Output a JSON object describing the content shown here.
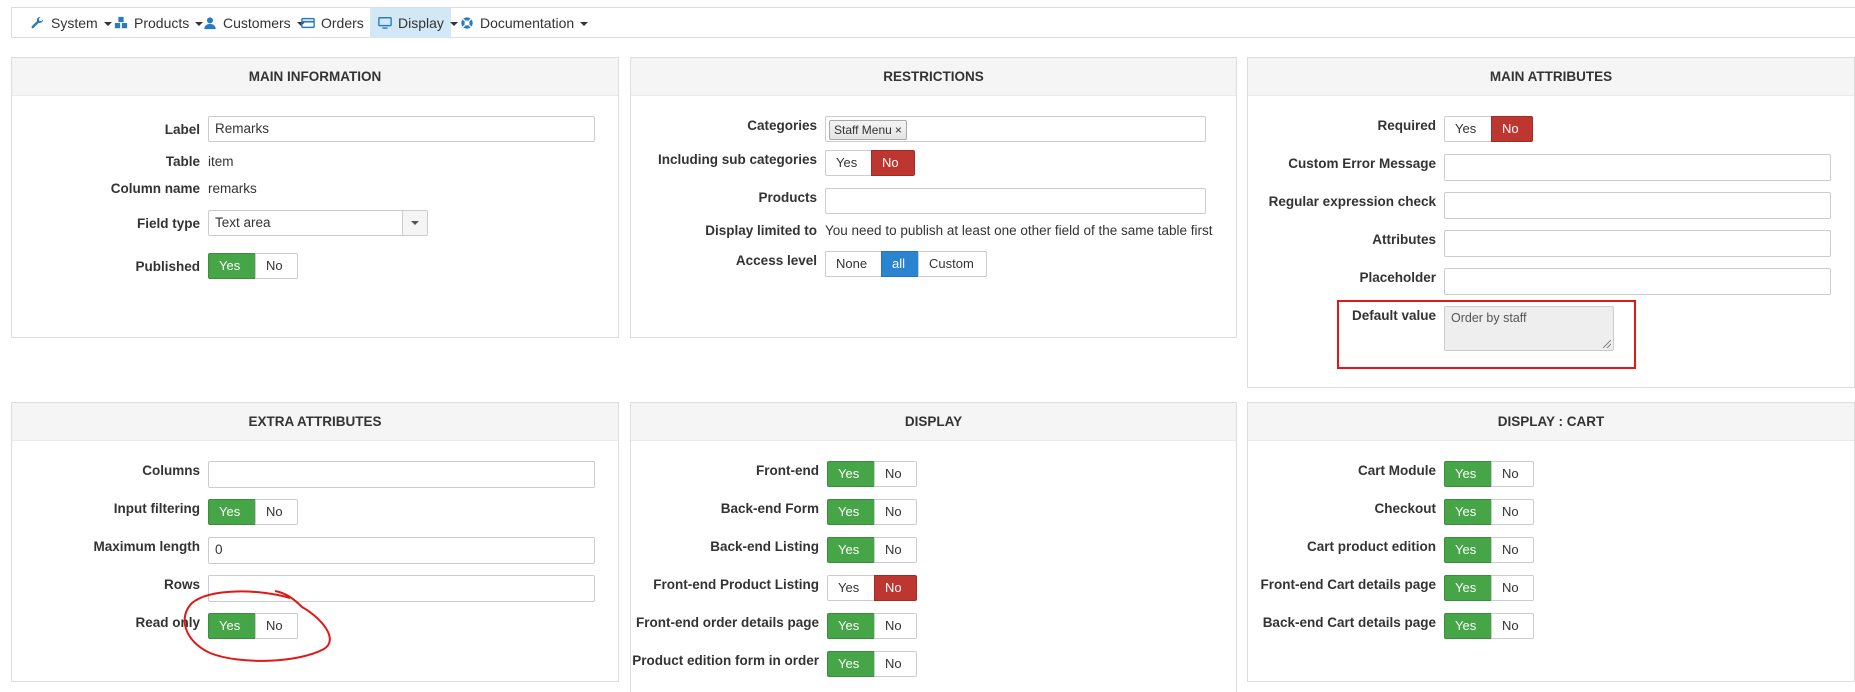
{
  "nav": {
    "items": [
      {
        "label": "System",
        "icon": "wrench-icon"
      },
      {
        "label": "Products",
        "icon": "cubes-icon"
      },
      {
        "label": "Customers",
        "icon": "user-icon"
      },
      {
        "label": "Orders",
        "icon": "credit-card-icon"
      },
      {
        "label": "Display",
        "icon": "monitor-icon"
      },
      {
        "label": "Documentation",
        "icon": "lifebuoy-icon"
      }
    ],
    "active": "Display"
  },
  "main_info": {
    "title": "MAIN INFORMATION",
    "label_lbl": "Label",
    "label_val": "Remarks",
    "table_lbl": "Table",
    "table_val": "item",
    "column_lbl": "Column name",
    "column_val": "remarks",
    "fieldtype_lbl": "Field type",
    "fieldtype_val": "Text area",
    "published_lbl": "Published",
    "yes": "Yes",
    "no": "No"
  },
  "restrictions": {
    "title": "RESTRICTIONS",
    "categories_lbl": "Categories",
    "category_tag": "Staff Menu",
    "remove": "×",
    "subcat_lbl": "Including sub categories",
    "yes": "Yes",
    "no": "No",
    "products_lbl": "Products",
    "limited_lbl": "Display limited to",
    "limited_val": "You need to publish at least one other field of the same table first",
    "access_lbl": "Access level",
    "access_none": "None",
    "access_all": "all",
    "access_custom": "Custom"
  },
  "main_attr": {
    "title": "MAIN ATTRIBUTES",
    "required_lbl": "Required",
    "yes": "Yes",
    "no": "No",
    "error_lbl": "Custom Error Message",
    "regex_lbl": "Regular expression check",
    "attributes_lbl": "Attributes",
    "placeholder_lbl": "Placeholder",
    "default_lbl": "Default value",
    "default_val": "Order by staff"
  },
  "extra_attr": {
    "title": "EXTRA ATTRIBUTES",
    "columns_lbl": "Columns",
    "filter_lbl": "Input filtering",
    "yes": "Yes",
    "no": "No",
    "maxlen_lbl": "Maximum length",
    "maxlen_val": "0",
    "rows_lbl": "Rows",
    "readonly_lbl": "Read only"
  },
  "display": {
    "title": "DISPLAY",
    "yes": "Yes",
    "no": "No",
    "rows": [
      {
        "label": "Front-end",
        "value": "Yes"
      },
      {
        "label": "Back-end Form",
        "value": "Yes"
      },
      {
        "label": "Back-end Listing",
        "value": "Yes"
      },
      {
        "label": "Front-end Product Listing",
        "value": "No"
      },
      {
        "label": "Front-end order details page",
        "value": "Yes"
      },
      {
        "label": "Product edition form in order",
        "value": "Yes"
      }
    ]
  },
  "display_cart": {
    "title": "DISPLAY : CART",
    "yes": "Yes",
    "no": "No",
    "rows": [
      {
        "label": "Cart Module",
        "value": "Yes"
      },
      {
        "label": "Checkout",
        "value": "Yes"
      },
      {
        "label": "Cart product edition",
        "value": "Yes"
      },
      {
        "label": "Front-end Cart details page",
        "value": "Yes"
      },
      {
        "label": "Back-end Cart details page",
        "value": "Yes"
      }
    ]
  },
  "colors": {
    "yes": "#46a546",
    "no": "#bd362f",
    "all": "#2a85d0",
    "annotation": "#e01818"
  }
}
